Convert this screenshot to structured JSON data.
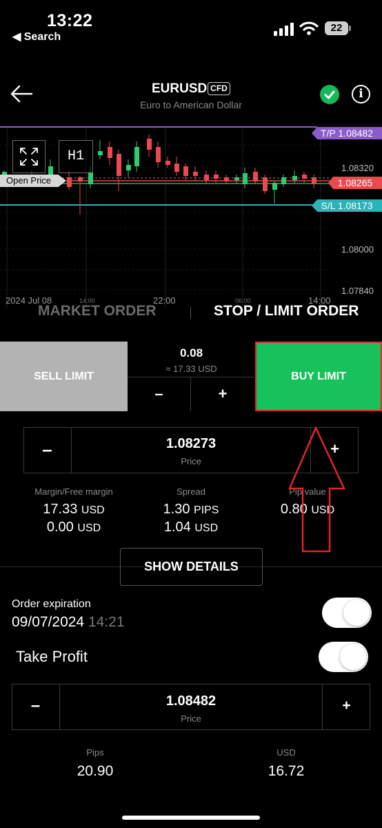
{
  "status_bar": {
    "time": "13:22",
    "back_app": "◀ Search",
    "battery": "22"
  },
  "header": {
    "symbol": "EURUSD",
    "badge": "CFD",
    "subtitle": "Euro to American Dollar"
  },
  "chart": {
    "timeframe": "H1",
    "tp_label": "T/P 1.08482",
    "sl_label": "S/L 1.08173",
    "current_price": "1.08265",
    "open_price_label": "Open Price",
    "y_ticks": [
      "1.08320",
      "1.08000",
      "1.07840"
    ],
    "x_ticks": [
      "2024 Jul 08",
      "14:00",
      "22:00",
      "06:00",
      "14:00"
    ],
    "colors": {
      "up": "#2ecc71",
      "down": "#e84a4f",
      "tp": "#8a5cc9",
      "sl": "#2bb3b8"
    }
  },
  "tabs": {
    "market": "MARKET ORDER",
    "stop_limit": "STOP / LIMIT ORDER"
  },
  "trade": {
    "sell_label": "SELL LIMIT",
    "buy_label": "BUY LIMIT",
    "volume": "0.08",
    "volume_usd": "≈ 17.33 USD",
    "minus": "–",
    "plus": "+"
  },
  "price": {
    "value": "1.08273",
    "caption": "Price",
    "minus": "–",
    "plus": "+"
  },
  "stats": {
    "margin_label": "Margin/Free margin",
    "margin_value": "17.33",
    "free_margin_value": "0.00",
    "spread_label": "Spread",
    "spread_value": "1.30",
    "spread_unit": "PIPS",
    "spread_usd": "1.04",
    "pip_label": "Pip value",
    "pip_value": "0.80",
    "usd": "USD"
  },
  "show_details": "SHOW DETAILS",
  "expiration": {
    "label": "Order expiration",
    "date": "09/07/2024",
    "time": "14:21"
  },
  "take_profit": {
    "title": "Take Profit",
    "value": "1.08482",
    "caption": "Price",
    "minus": "–",
    "plus": "+",
    "pips_label": "Pips",
    "pips_value": "20.90",
    "usd_label": "USD",
    "usd_value": "16.72"
  }
}
